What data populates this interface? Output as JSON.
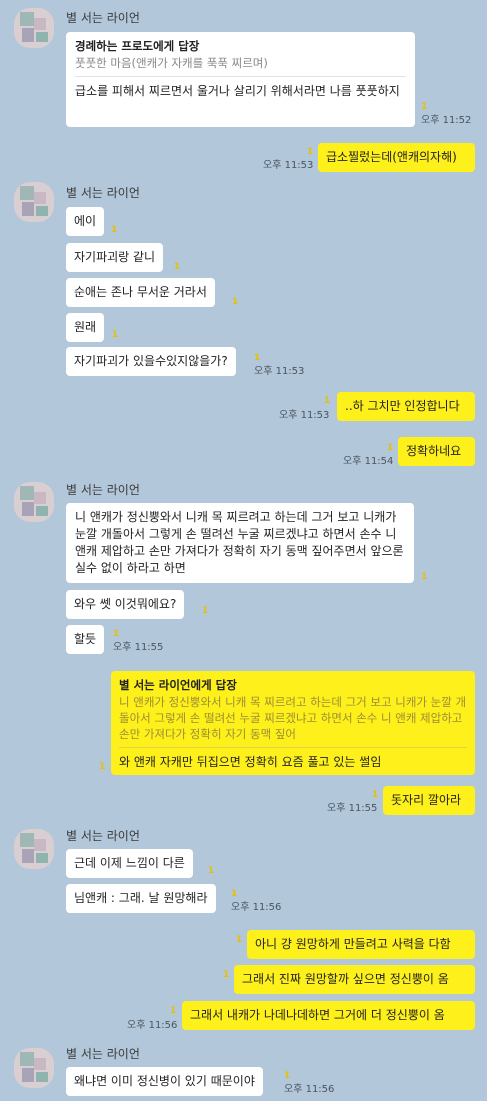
{
  "sender_name": "별 서는 라이언",
  "unread_mark": "1",
  "messages": {
    "m1_reply_to": "경례하는 프로도에게 답장",
    "m1_quote": "풋풋한 마음(앤캐가 자캐를 푹푹 찌르며)",
    "m1_text": "급소를 피해서 찌르면서 울거나 살리기 위해서라면 나름 풋풋하지",
    "m1_time": "오후 11:52",
    "m2_text": "급소찔렀는데(앤캐의자해)",
    "m2_time": "오후 11:53",
    "m3_text": "에이",
    "m4_text": "자기파괴랑 같니",
    "m5_text": "순애는 존나 무서운 거라서",
    "m6_text": "원래",
    "m7_text": "자기파괴가 있을수있지않을가?",
    "m7_time": "오후 11:53",
    "m8_text": "..하 그치만 인정합니다",
    "m8_time": "오후 11:53",
    "m9_text": "정확하네요",
    "m9_time": "오후 11:54",
    "m10_text": "니 앤캐가 정신뿡와서 니캐 목 찌르려고 하는데 그거 보고 니캐가 눈깔 개돌아서 그렇게 손 떨려선 누굴 찌르겠냐고 하면서 손수 니 앤캐 제압하고 손만 가져다가 정확히 자기 동맥 짚어주면서 앞으론 실수 없이 하라고 하면",
    "m11_text": "와우 쎗 이것뭐에요?",
    "m12_text": "할듯",
    "m12_time": "오후 11:55",
    "m13_reply_to": "별 서는 라이언에게 답장",
    "m13_quote": "니 앤캐가 정신뿡와서 니캐 목 찌르려고 하는데 그거 보고 니캐가 눈깔 개돌아서 그렇게 손 떨려선 누굴 찌르겠냐고 하면서 손수 니 앤캐 제압하고 손만 가져다가 정확히 자기 동맥 짚어",
    "m13_text": "와 앤캐 자캐만 뒤집으면 정확히 요즘 풀고 있는 썰임",
    "m14_text": "돗자리 깔아라",
    "m14_time": "오후 11:55",
    "m15_text": "근데 이제 느낌이 다른",
    "m16_text": "님앤캐 : 그래. 날 원망해라",
    "m16_time": "오후 11:56",
    "m17_text": "아니 걍 원망하게 만들려고 사력을 다함",
    "m18_text": "그래서 진짜 원망할까 싶으면 정신뿡이 옴",
    "m19_text": "그래서 내캐가 나데나데하면 그거에 더 정신뿡이 옴",
    "m19_time": "오후 11:56",
    "m20_text": "왜냐면 이미 정신병이 있기 때문이야",
    "m20_time": "오후 11:56"
  },
  "colors": {
    "background": "#b2c7d9",
    "my_bubble": "#fef01b",
    "other_bubble": "#ffffff",
    "unread": "#e7c000"
  },
  "icons": {
    "avatar": "pixelated-profile-avatar"
  }
}
